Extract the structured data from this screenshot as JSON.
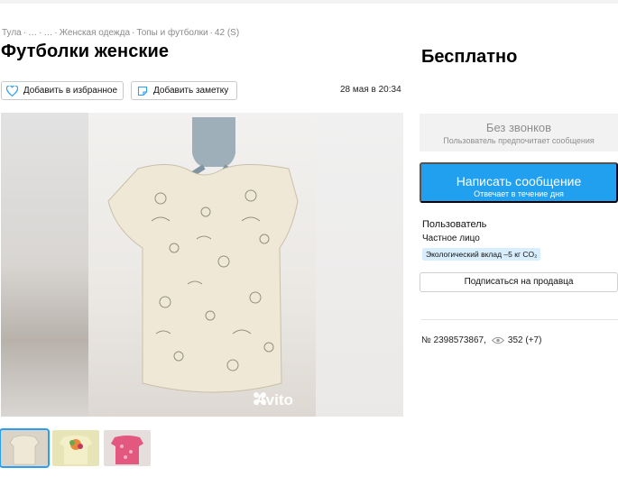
{
  "breadcrumb": {
    "items": [
      "Тула",
      "…",
      "…",
      "Женская одежда",
      "Топы и футболки",
      "42 (S)"
    ],
    "separator": "·"
  },
  "listing": {
    "title": "Футболки женские",
    "price": "Бесплатно",
    "date": "28 мая в 20:34",
    "id_label": "№ 2398573867,",
    "views": "352 (+7)"
  },
  "actions": {
    "favorite_label": "Добавить в избранное",
    "note_label": "Добавить заметку"
  },
  "contact": {
    "no_calls_title": "Без звонков",
    "no_calls_sub": "Пользователь предпочитает сообщения",
    "write_title": "Написать сообщение",
    "write_sub": "Отвечает в течение дня"
  },
  "seller": {
    "name": "Пользователь",
    "type": "Частное лицо",
    "eco_badge": "Экологический вклад –5 кг CO₂",
    "subscribe_label": "Подписаться на продавца"
  },
  "gallery": {
    "watermark": "Avito",
    "thumbnails": [
      {
        "name": "thumb-1",
        "active": true
      },
      {
        "name": "thumb-2",
        "active": false
      },
      {
        "name": "thumb-3",
        "active": false
      }
    ]
  },
  "colors": {
    "accent": "#21a0f0",
    "badge_bg": "#d8eefc",
    "muted_text": "#8a8a8a"
  },
  "icons": {
    "favorite": "heart-icon",
    "note": "note-icon",
    "views": "eye-icon",
    "watermark": "avito-logo-icon"
  }
}
